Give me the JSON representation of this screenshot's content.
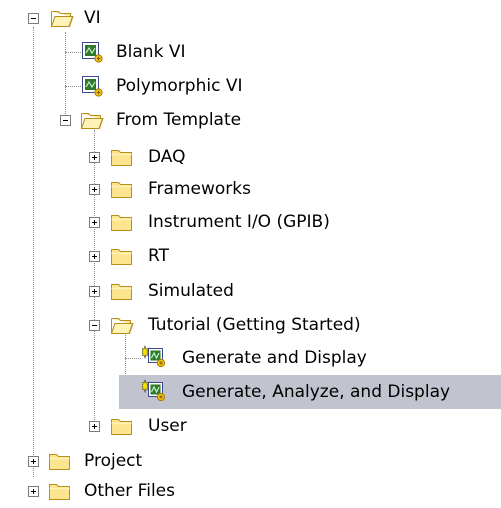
{
  "tree": {
    "nodes": [
      {
        "key": "vi",
        "label": "VI",
        "icon": "folder-open-icon",
        "expanded": true
      },
      {
        "key": "blank-vi",
        "label": "Blank VI",
        "icon": "vi-file-icon"
      },
      {
        "key": "polymorphic-vi",
        "label": "Polymorphic VI",
        "icon": "vi-file-icon"
      },
      {
        "key": "from-template",
        "label": "From Template",
        "icon": "folder-open-icon",
        "expanded": true
      },
      {
        "key": "daq",
        "label": "DAQ",
        "icon": "folder-closed-icon",
        "expanded": false
      },
      {
        "key": "frameworks",
        "label": "Frameworks",
        "icon": "folder-closed-icon",
        "expanded": false
      },
      {
        "key": "instrument-io",
        "label": "Instrument I/O (GPIB)",
        "icon": "folder-closed-icon",
        "expanded": false
      },
      {
        "key": "rt",
        "label": "RT",
        "icon": "folder-closed-icon",
        "expanded": false
      },
      {
        "key": "simulated",
        "label": "Simulated",
        "icon": "folder-closed-icon",
        "expanded": false
      },
      {
        "key": "tutorial",
        "label": "Tutorial (Getting Started)",
        "icon": "folder-open-icon",
        "expanded": true
      },
      {
        "key": "generate-and-display",
        "label": "Generate and Display",
        "icon": "vi-template-icon"
      },
      {
        "key": "generate-analyze-display",
        "label": "Generate, Analyze, and Display",
        "icon": "vi-template-icon",
        "selected": true
      },
      {
        "key": "user",
        "label": "User",
        "icon": "folder-closed-icon",
        "expanded": false
      },
      {
        "key": "project",
        "label": "Project",
        "icon": "folder-closed-icon",
        "expanded": false
      },
      {
        "key": "other-files",
        "label": "Other Files",
        "icon": "folder-closed-icon",
        "expanded": false
      }
    ]
  },
  "colors": {
    "selection": "#c1c3ce",
    "folder_fill": "#fde58f",
    "folder_stroke": "#b98f1c",
    "tree_line": "#8c8c8c"
  }
}
